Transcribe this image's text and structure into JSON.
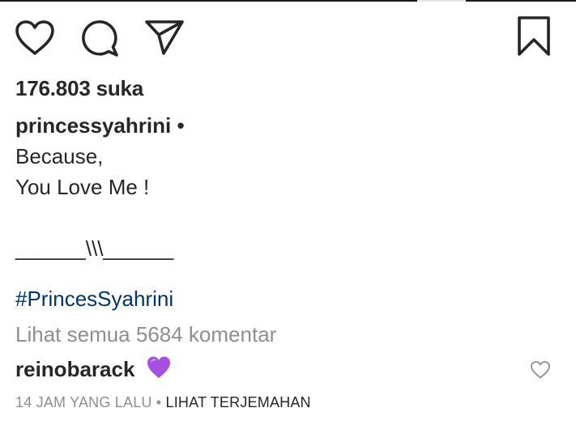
{
  "actions": {
    "like_icon": "heart-outline-icon",
    "comment_icon": "comment-bubble-icon",
    "share_icon": "paper-plane-icon",
    "save_icon": "bookmark-outline-icon"
  },
  "likes": {
    "text": "176.803 suka"
  },
  "caption": {
    "username": "princessyahrini",
    "dot": "•",
    "lines": [
      "Because,",
      "You Love Me !",
      "",
      "______\\\\\\______"
    ]
  },
  "hashtag": "#PrincesSyahrini",
  "view_all_comments": "Lihat semua 5684 komentar",
  "comment": {
    "username": "reinobarack",
    "emoji": "purple-heart-icon",
    "like_icon": "small-heart-outline-icon"
  },
  "meta": {
    "time": "14 JAM YANG LALU",
    "separator": " • ",
    "translate": "LIHAT TERJEMAHAN"
  },
  "colors": {
    "text": "#262626",
    "muted": "#8e8e8e",
    "hashtag": "#003569",
    "purple_heart": "#a64fe0"
  }
}
